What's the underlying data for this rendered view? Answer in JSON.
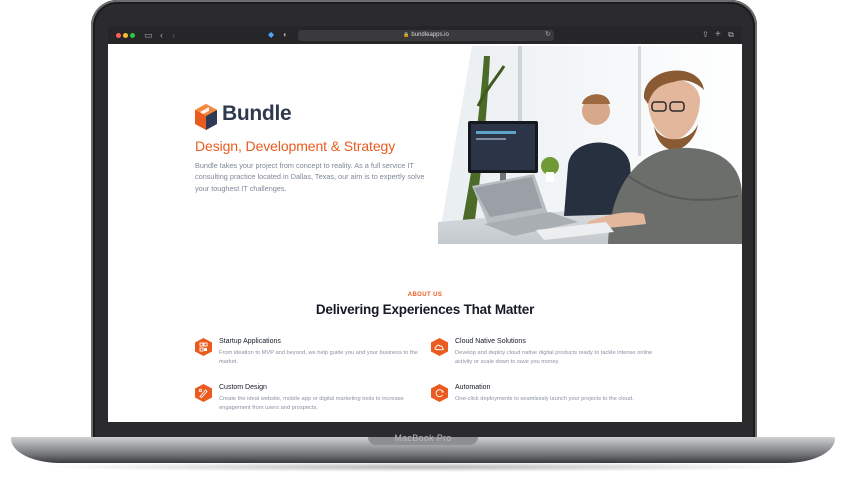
{
  "device": {
    "label": "MacBook Pro"
  },
  "browser": {
    "url": "bundleapps.io",
    "icons": {
      "sidebar": "sidebar-icon",
      "back": "back-chevron-icon",
      "forward": "forward-chevron-icon",
      "reload": "reload-icon",
      "share": "share-icon",
      "new_tab": "plus-icon",
      "tabs": "tabs-icon"
    }
  },
  "hero": {
    "logo_text": "Bundle",
    "title": "Design, Development & Strategy",
    "description": "Bundle takes your project from concept to reality. As a full service IT consulting practice located in Dallas, Texas, our aim is to expertly solve your toughest IT challenges."
  },
  "about": {
    "eyebrow": "ABOUT US",
    "title": "Delivering Experiences That Matter",
    "features": [
      {
        "title": "Startup Applications",
        "description": "From ideation to MVP and beyond, we help guide you and your business to the market.",
        "icon": "startup-icon"
      },
      {
        "title": "Cloud Native Solutions",
        "description": "Develop and deploy cloud native digital products ready to tackle intense online activity or scale down to save you money.",
        "icon": "cloud-icon"
      },
      {
        "title": "Custom Design",
        "description": "Create the ideal website, mobile app or digital marketing tools to increase engagement from users and prospects.",
        "icon": "design-icon"
      },
      {
        "title": "Automation",
        "description": "One-click deployments to seamlessly launch your projects to the cloud.",
        "icon": "automation-icon"
      }
    ]
  },
  "colors": {
    "accent": "#ea5b1f",
    "heading": "#141a26",
    "logo_navy": "#303a4e",
    "body_text": "#7f8799"
  }
}
